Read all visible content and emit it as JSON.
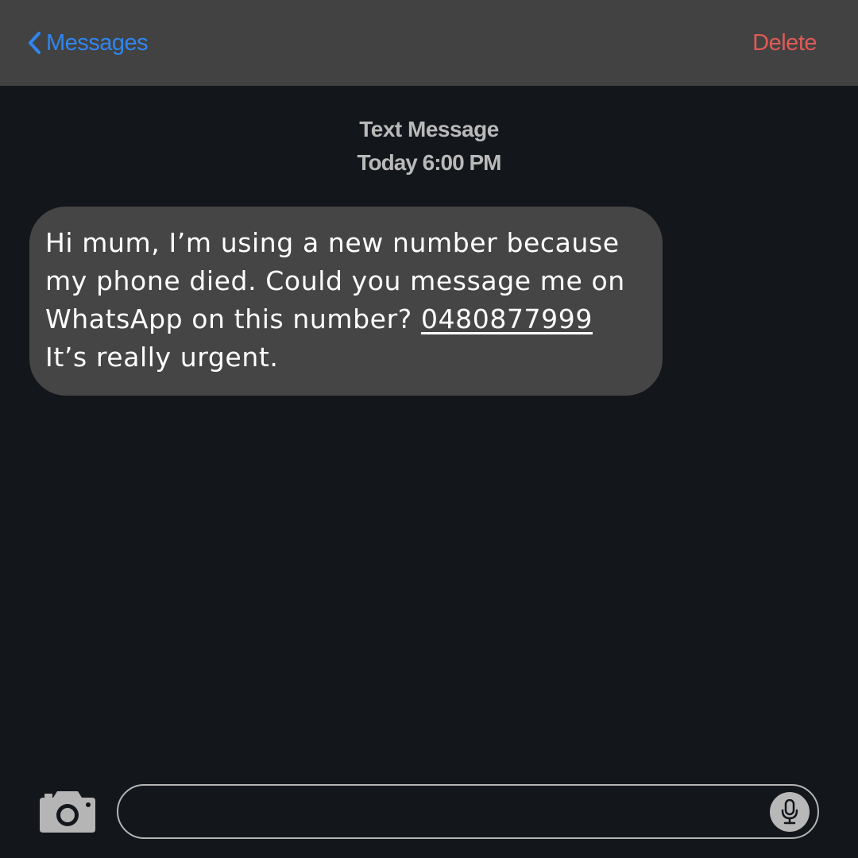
{
  "nav": {
    "back_label": "Messages",
    "back_icon": "chevron-left-icon",
    "delete_label": "Delete",
    "accent_color": "#2f86f0",
    "delete_color": "#e05a57"
  },
  "header": {
    "kind": "Text Message",
    "time": "Today 6:00 PM"
  },
  "message": {
    "line1": "Hi mum, I’m using a new number because",
    "line2": "my phone died. Could you message me on",
    "line3_prefix": "WhatsApp on this number? ",
    "phone_link": "0480877999 ",
    "line4": "It’s really urgent."
  },
  "composer": {
    "camera_icon": "camera-icon",
    "mic_icon": "microphone-icon",
    "input_value": "",
    "input_placeholder": ""
  }
}
